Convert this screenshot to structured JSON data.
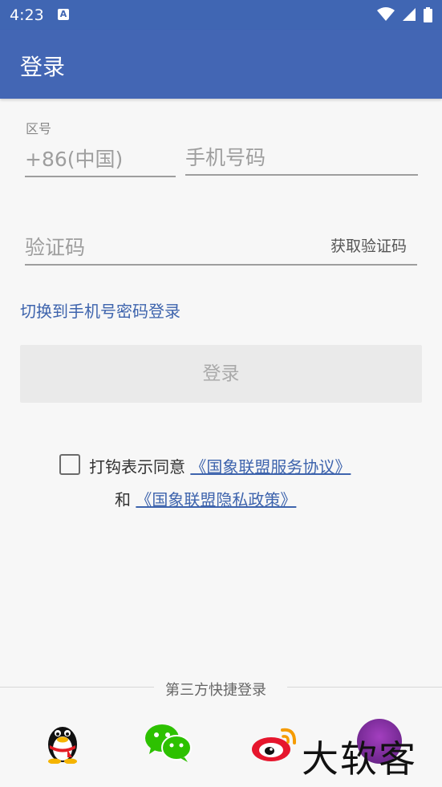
{
  "status": {
    "time": "4:23",
    "notif_badge": "A"
  },
  "app_bar": {
    "title": "登录"
  },
  "form": {
    "area_code_label": "区号",
    "area_code_value": "+86(中国)",
    "phone_placeholder": "手机号码",
    "code_placeholder": "验证码",
    "get_code_label": "获取验证码",
    "switch_label": "切换到手机号密码登录",
    "login_label": "登录"
  },
  "agreement": {
    "prefix": "打钩表示同意",
    "service_link": "《国象联盟服务协议》",
    "conjunction": "和",
    "privacy_link": "《国象联盟隐私政策》"
  },
  "third_party": {
    "title": "第三方快捷登录",
    "icons": [
      "qq-icon",
      "wechat-icon",
      "weibo-icon"
    ],
    "watermark": "大软客"
  }
}
